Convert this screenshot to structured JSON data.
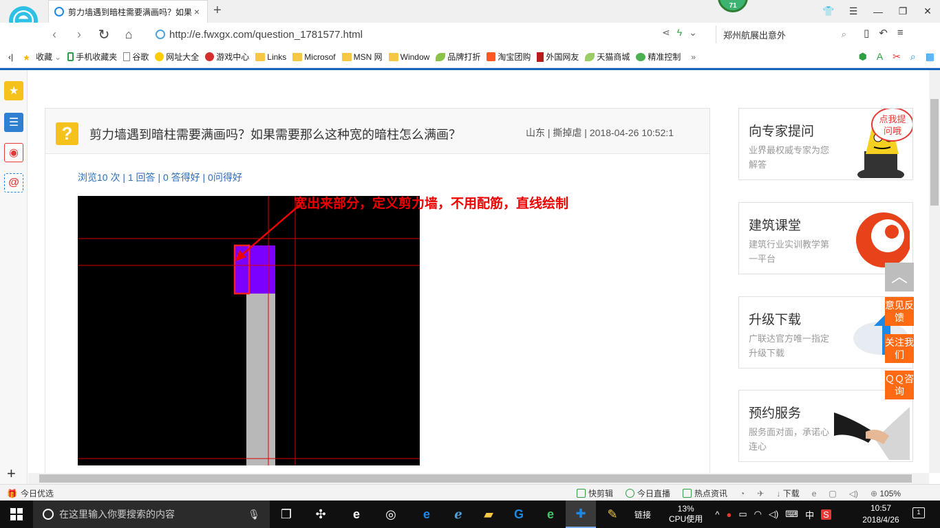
{
  "browser": {
    "tab_title": "剪力墙遇到暗柱需要满画吗？如果",
    "tab_close": "×",
    "new_tab": "+",
    "badge": "71",
    "url": "http://e.fwxgx.com/question_1781577.html",
    "search_text": "郑州航展出意外"
  },
  "bookmarks": [
    {
      "label": "收藏",
      "icon": "star-icon"
    },
    {
      "label": "手机收藏夹",
      "icon": "phone-icon"
    },
    {
      "label": "谷歌",
      "icon": "page-icon"
    },
    {
      "label": "网址大全",
      "icon": "globe-icon"
    },
    {
      "label": "游戏中心",
      "icon": "game-icon"
    },
    {
      "label": "Links",
      "icon": "folder-icon"
    },
    {
      "label": "Microsof",
      "icon": "folder-icon"
    },
    {
      "label": "MSN 网",
      "icon": "folder-icon"
    },
    {
      "label": "Window",
      "icon": "folder-icon"
    },
    {
      "label": "品牌打折",
      "icon": "leaf-icon"
    },
    {
      "label": "淘宝团购",
      "icon": "taobao-icon"
    },
    {
      "label": "外国网友",
      "icon": "bookmark-icon"
    },
    {
      "label": "天猫商城",
      "icon": "leaf-icon"
    },
    {
      "label": "精准控制",
      "icon": "chat-icon"
    }
  ],
  "question": {
    "icon_char": "?",
    "title": "剪力墙遇到暗柱需要满画吗？如果需要那么这种宽的暗柱怎么满画？",
    "meta": "山东 | 撕掉虐 | 2018-04-26 10:52:1",
    "stats": "浏览10 次 | 1 回答 | 0 答得好 | 0问得好",
    "annotation": "宽出来部分，定义剪力墙，不用配筋，直线绘制"
  },
  "cards": [
    {
      "title": "向专家提问",
      "sub": "业界最权威专家为您解答",
      "bubble": "点我提问哦"
    },
    {
      "title": "建筑课堂",
      "sub": "建筑行业实训教学第一平台"
    },
    {
      "title": "升级下载",
      "sub": "广联达官方唯一指定升级下载"
    },
    {
      "title": "预约服务",
      "sub": "服务面对面，承诺心连心"
    }
  ],
  "float_buttons": {
    "top": "︿",
    "feedback": "意见反馈",
    "follow": "关注我们",
    "qq": "ＱＱ咨询"
  },
  "statusbar": {
    "left": "今日优选",
    "items": [
      "快剪辑",
      "今日直播",
      "热点资讯",
      "下载"
    ],
    "zoom": "105%"
  },
  "taskbar": {
    "search_placeholder": "在这里输入你要搜索的内容",
    "links": "链接",
    "cpu_percent": "13%",
    "cpu_label": "CPU使用",
    "ime": "中",
    "time": "10:57",
    "date": "2018/4/26",
    "notification_count": "1"
  },
  "colors": {
    "accent": "#1565c0",
    "orange": "#ff6a13",
    "annotation_red": "#ee0000",
    "cad_purple": "#7b00ff"
  }
}
